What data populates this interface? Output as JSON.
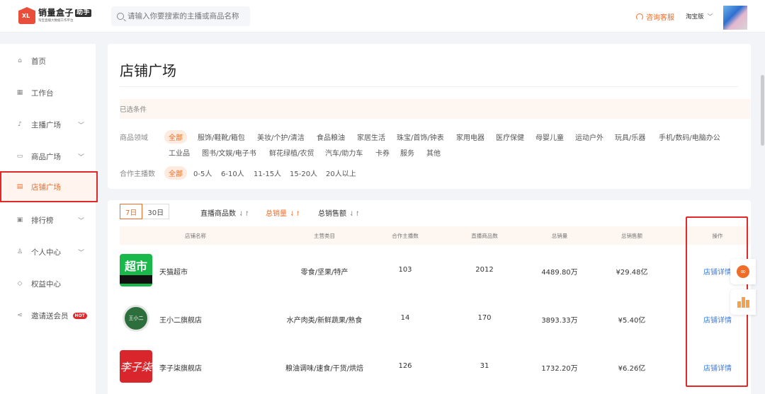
{
  "header": {
    "logo_mark": "XL",
    "logo_title": "销量盒子",
    "logo_badge": "助手",
    "logo_sub": "淘宝直播大数据工作平台",
    "search_placeholder": "请输入你要搜索的主播或商品名称",
    "service_label": "咨询客服",
    "platform_label": "淘宝版"
  },
  "sidebar": {
    "items": [
      {
        "label": "首页",
        "icon": "home-icon"
      },
      {
        "label": "工作台",
        "icon": "grid-icon"
      },
      {
        "label": "主播广场",
        "icon": "mic-icon",
        "expandable": true
      },
      {
        "label": "商品广场",
        "icon": "bag-icon",
        "expandable": true
      },
      {
        "label": "店铺广场",
        "icon": "store-icon",
        "active": true
      },
      {
        "label": "排行榜",
        "icon": "rank-icon",
        "expandable": true
      },
      {
        "label": "个人中心",
        "icon": "user-icon",
        "expandable": true
      },
      {
        "label": "权益中心",
        "icon": "diamond-icon"
      },
      {
        "label": "邀请送会员",
        "icon": "share-icon",
        "badge": "HOT"
      }
    ]
  },
  "page": {
    "title": "店铺广场",
    "selected_conditions_label": "已选条件",
    "category_label": "商品领域",
    "categories": [
      "全部",
      "服饰/鞋靴/箱包",
      "美妆/个护/清洁",
      "食品粮油",
      "家居生活",
      "珠宝/首饰/钟表",
      "家用电器",
      "医疗保健",
      "母婴儿童",
      "运动户外",
      "玩具/乐器",
      "手机/数码/电脑办公",
      "工业品",
      "图书/文娱/电子书",
      "鲜花绿植/农贸",
      "汽车/助力车",
      "卡券",
      "服务",
      "其他"
    ],
    "anchor_count_label": "合作主播数",
    "anchor_counts": [
      "全部",
      "0-5人",
      "6-10人",
      "11-15人",
      "15-20人",
      "20人以上"
    ]
  },
  "table": {
    "tabs": [
      "7日",
      "30日"
    ],
    "sorts": [
      "直播商品数",
      "总销量",
      "总销售额"
    ],
    "sort_icon": "⇃↾",
    "columns": [
      "店铺名称",
      "主营类目",
      "合作主播数",
      "直播商品数",
      "总销量",
      "总销售额",
      "操作"
    ],
    "rows": [
      {
        "logo_text": "超市",
        "name": "天猫超市",
        "category": "零食/坚果/特产",
        "anchors": "103",
        "products": "2012",
        "sales": "4489.80万",
        "revenue": "¥29.48亿",
        "action": "店铺详情"
      },
      {
        "logo_text": "王小二",
        "name": "王小二旗舰店",
        "category": "水产肉类/新鲜蔬果/熟食",
        "anchors": "14",
        "products": "170",
        "sales": "3893.33万",
        "revenue": "¥5.40亿",
        "action": "店铺详情"
      },
      {
        "logo_text": "李子柒",
        "name": "李子柒旗舰店",
        "category": "粮油调味/速食/干货/烘焙",
        "anchors": "126",
        "products": "31",
        "sales": "1732.20万",
        "revenue": "¥6.26亿",
        "action": "店铺详情"
      }
    ]
  },
  "colors": {
    "accent": "#f06d29",
    "highlight_box": "#e3282a",
    "link": "#3a7be0"
  }
}
